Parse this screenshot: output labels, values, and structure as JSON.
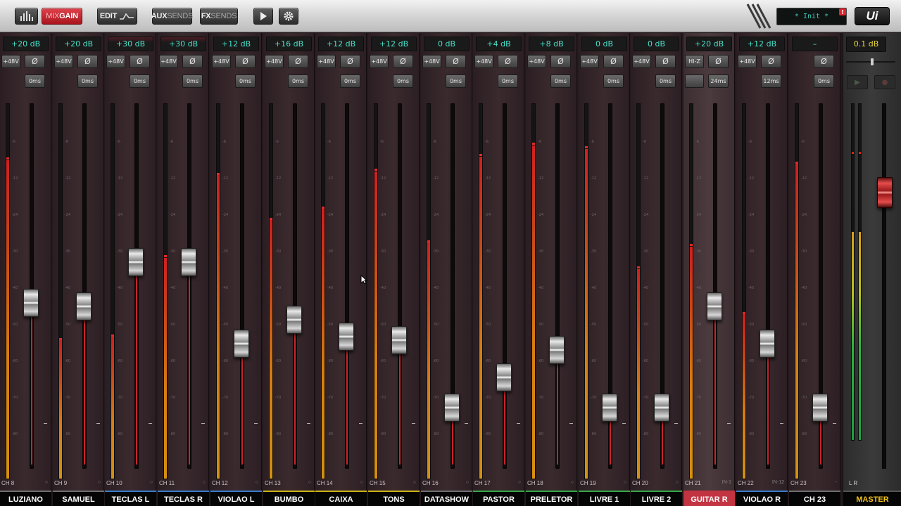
{
  "toolbar": {
    "mixer_icon": "mixer-bars-icon",
    "mix_gain": {
      "mix": "MIX",
      "gain": "GAIN"
    },
    "edit_label": "EDIT",
    "aux_sends": {
      "aux": "AUX",
      "sends": "SENDS"
    },
    "fx_sends": {
      "fx": "FX",
      "sends": "SENDS"
    },
    "play_icon": "play-icon",
    "settings_icon": "gear-icon",
    "status_text": "* Init *",
    "alert_badge": "!",
    "logo": "Ui"
  },
  "colors": {
    "gain_text": "#47e0c8",
    "master_text": "#f2c21a",
    "fader_level": "#c8242c",
    "selected_channel_name_bg": "#c23442"
  },
  "channels": [
    {
      "name": "LUZIANO",
      "ch": "CH 8",
      "gain": "+20 dB",
      "phantom": "+48V",
      "phase": "Ø",
      "delay": "0ms",
      "fader": 0.45,
      "meter": 0.85,
      "sub": "",
      "accent": "#6f6f6f"
    },
    {
      "name": "SAMUEL",
      "ch": "CH 9",
      "gain": "+20 dB",
      "phantom": "+48V",
      "phase": "Ø",
      "delay": "0ms",
      "fader": 0.44,
      "meter": 0.37,
      "sub": "",
      "accent": "#6f6f6f"
    },
    {
      "name": "TECLAS L",
      "ch": "CH 10",
      "gain": "+30 dB",
      "phantom": "+48V",
      "phase": "Ø",
      "delay": "0ms",
      "fader": 0.57,
      "meter": 0.38,
      "sub": "",
      "accent": "#3b7bc8"
    },
    {
      "name": "TECLAS R",
      "ch": "CH 11",
      "gain": "+30 dB",
      "phantom": "+48V",
      "phase": "Ø",
      "delay": "0ms",
      "fader": 0.57,
      "meter": 0.59,
      "sub": "",
      "accent": "#3b7bc8"
    },
    {
      "name": "VIOLAO L",
      "ch": "CH 12",
      "gain": "+12 dB",
      "phantom": "+48V",
      "phase": "Ø",
      "delay": "0ms",
      "fader": 0.33,
      "meter": 0.81,
      "sub": "",
      "accent": "#3b7bc8"
    },
    {
      "name": "BUMBO",
      "ch": "CH 13",
      "gain": "+16 dB",
      "phantom": "+48V",
      "phase": "Ø",
      "delay": "0ms",
      "fader": 0.4,
      "meter": 0.69,
      "sub": "",
      "accent": "#cbb31c"
    },
    {
      "name": "CAIXA",
      "ch": "CH 14",
      "gain": "+12 dB",
      "phantom": "+48V",
      "phase": "Ø",
      "delay": "0ms",
      "fader": 0.35,
      "meter": 0.72,
      "sub": "",
      "accent": "#cbb31c"
    },
    {
      "name": "TONS",
      "ch": "CH 15",
      "gain": "+12 dB",
      "phantom": "+48V",
      "phase": "Ø",
      "delay": "0ms",
      "fader": 0.34,
      "meter": 0.82,
      "sub": "",
      "accent": "#cbb31c"
    },
    {
      "name": "DATASHOW",
      "ch": "CH 16",
      "gain": "0 dB",
      "phantom": "+48V",
      "phase": "Ø",
      "delay": "0ms",
      "fader": 0.14,
      "meter": 0.63,
      "sub": "",
      "accent": "#6f6f6f"
    },
    {
      "name": "PASTOR",
      "ch": "CH 17",
      "gain": "+4 dB",
      "phantom": "+48V",
      "phase": "Ø",
      "delay": "0ms",
      "fader": 0.23,
      "meter": 0.86,
      "sub": "",
      "accent": "#37a64a"
    },
    {
      "name": "PRELETOR",
      "ch": "CH 18",
      "gain": "+8 dB",
      "phantom": "+48V",
      "phase": "Ø",
      "delay": "0ms",
      "fader": 0.31,
      "meter": 0.89,
      "sub": "",
      "accent": "#37a64a"
    },
    {
      "name": "LIVRE 1",
      "ch": "CH 19",
      "gain": "0 dB",
      "phantom": "+48V",
      "phase": "Ø",
      "delay": "0ms",
      "fader": 0.14,
      "meter": 0.88,
      "sub": "",
      "accent": "#37a64a"
    },
    {
      "name": "LIVRE 2",
      "ch": "CH 20",
      "gain": "0 dB",
      "phantom": "+48V",
      "phase": "Ø",
      "delay": "0ms",
      "fader": 0.14,
      "meter": 0.56,
      "sub": "",
      "accent": "#37a64a"
    },
    {
      "name": "GUITAR R",
      "ch": "CH 21",
      "gain": "+20 dB",
      "phantom": "HI-Z",
      "phase": "Ø",
      "delay": "24ms",
      "fader": 0.44,
      "meter": 0.62,
      "sub": "IN-1",
      "accent": "#c23442",
      "selected": true
    },
    {
      "name": "VIOLAO R",
      "ch": "CH 22",
      "gain": "+12 dB",
      "phantom": "+48V",
      "phase": "Ø",
      "delay": "12ms",
      "fader": 0.33,
      "meter": 0.44,
      "sub": "IN-12",
      "accent": "#3b7bc8"
    },
    {
      "name": "CH 23",
      "ch": "CH 23",
      "gain": "–",
      "phantom": "",
      "phase": "Ø",
      "delay": "0ms",
      "fader": 0.14,
      "meter": 0.84,
      "sub": "-",
      "accent": "#6f6f6f"
    }
  ],
  "scale_ticks": [
    "-6",
    "-12",
    "-24",
    "-30",
    "-40",
    "-50",
    "-60",
    "-70",
    "-80"
  ],
  "master": {
    "name": "MASTER",
    "gain": "0.1 dB",
    "lr": "L  R",
    "play_icon": "play-icon",
    "record_icon": "record-icon",
    "meter_l": 0.62,
    "meter_r": 0.62,
    "fader": 0.78
  }
}
